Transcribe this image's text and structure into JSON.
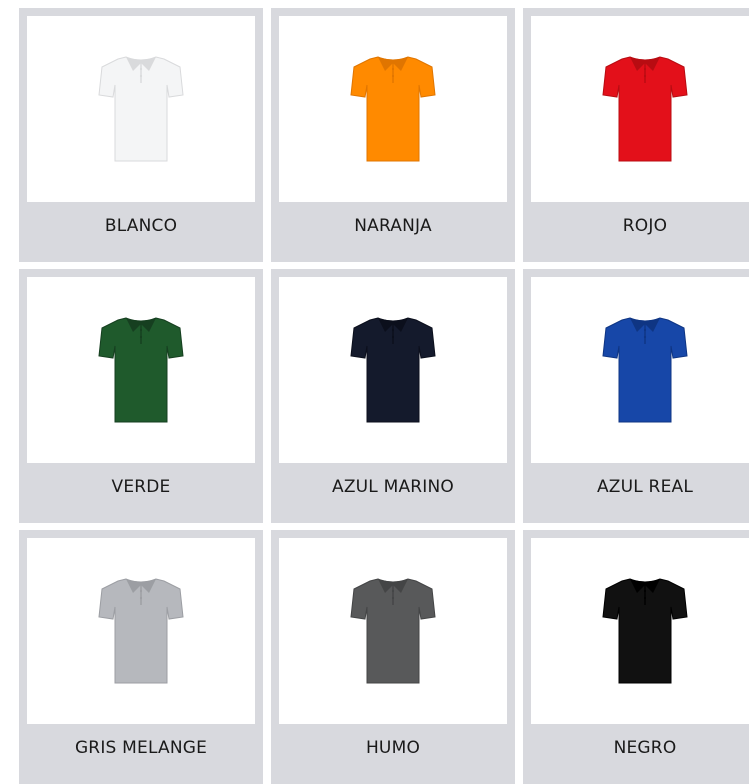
{
  "products": [
    {
      "label": "BLANCO",
      "color": "#f4f5f6",
      "shade": "#d9dadc",
      "icon": "polo-shirt-icon"
    },
    {
      "label": "NARANJA",
      "color": "#ff8a00",
      "shade": "#e07500",
      "icon": "polo-shirt-icon"
    },
    {
      "label": "ROJO",
      "color": "#e3101a",
      "shade": "#b80c12",
      "icon": "polo-shirt-icon"
    },
    {
      "label": "VERDE",
      "color": "#1f5a2c",
      "shade": "#163f20",
      "icon": "polo-shirt-icon"
    },
    {
      "label": "AZUL MARINO",
      "color": "#141a2c",
      "shade": "#0b0f1c",
      "icon": "polo-shirt-icon"
    },
    {
      "label": "AZUL REAL",
      "color": "#1747a8",
      "shade": "#0f3583",
      "icon": "polo-shirt-icon"
    },
    {
      "label": "GRIS MELANGE",
      "color": "#b6b8bd",
      "shade": "#9c9ea3",
      "icon": "polo-shirt-icon"
    },
    {
      "label": "HUMO",
      "color": "#58595a",
      "shade": "#444546",
      "icon": "polo-shirt-icon"
    },
    {
      "label": "NEGRO",
      "color": "#111111",
      "shade": "#000000",
      "icon": "polo-shirt-icon"
    }
  ],
  "colors": {
    "card_bg": "#d8d9de",
    "photo_bg": "#ffffff",
    "text": "#1a1a1a"
  }
}
